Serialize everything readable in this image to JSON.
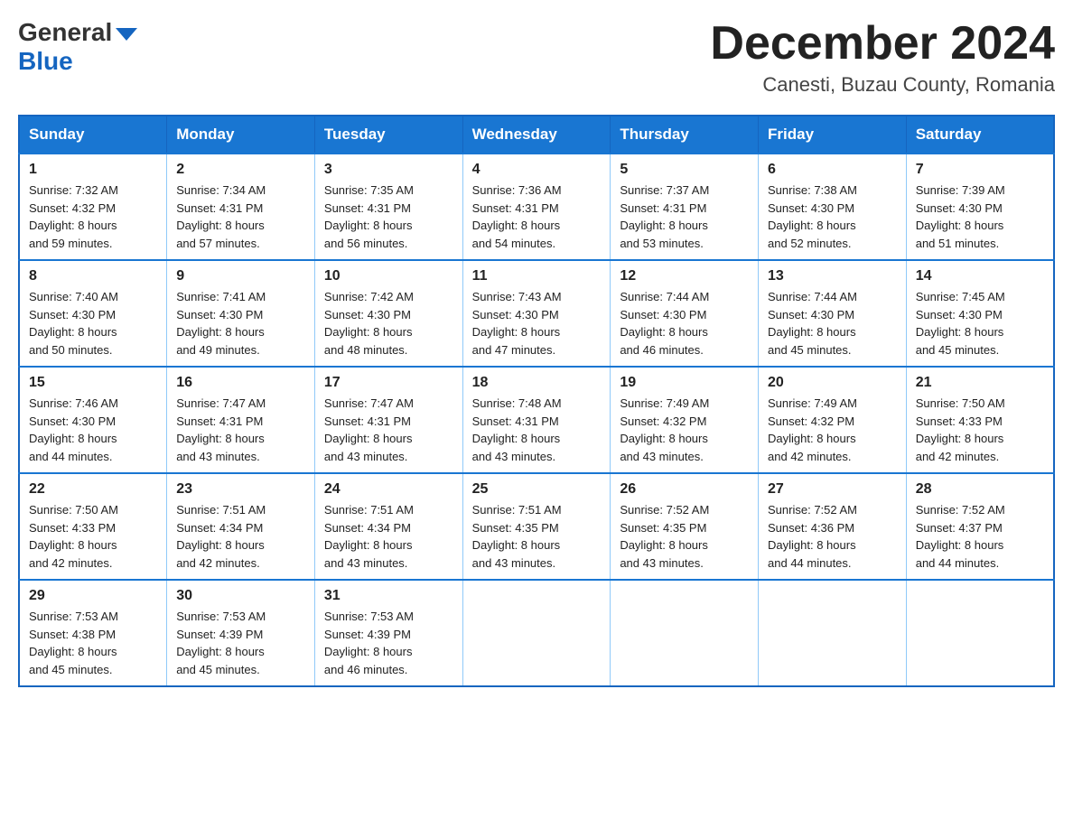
{
  "header": {
    "logo_general": "General",
    "logo_blue": "Blue",
    "month_title": "December 2024",
    "location": "Canesti, Buzau County, Romania"
  },
  "days_of_week": [
    "Sunday",
    "Monday",
    "Tuesday",
    "Wednesday",
    "Thursday",
    "Friday",
    "Saturday"
  ],
  "weeks": [
    [
      {
        "day": "1",
        "sunrise": "7:32 AM",
        "sunset": "4:32 PM",
        "daylight": "8 hours and 59 minutes."
      },
      {
        "day": "2",
        "sunrise": "7:34 AM",
        "sunset": "4:31 PM",
        "daylight": "8 hours and 57 minutes."
      },
      {
        "day": "3",
        "sunrise": "7:35 AM",
        "sunset": "4:31 PM",
        "daylight": "8 hours and 56 minutes."
      },
      {
        "day": "4",
        "sunrise": "7:36 AM",
        "sunset": "4:31 PM",
        "daylight": "8 hours and 54 minutes."
      },
      {
        "day": "5",
        "sunrise": "7:37 AM",
        "sunset": "4:31 PM",
        "daylight": "8 hours and 53 minutes."
      },
      {
        "day": "6",
        "sunrise": "7:38 AM",
        "sunset": "4:30 PM",
        "daylight": "8 hours and 52 minutes."
      },
      {
        "day": "7",
        "sunrise": "7:39 AM",
        "sunset": "4:30 PM",
        "daylight": "8 hours and 51 minutes."
      }
    ],
    [
      {
        "day": "8",
        "sunrise": "7:40 AM",
        "sunset": "4:30 PM",
        "daylight": "8 hours and 50 minutes."
      },
      {
        "day": "9",
        "sunrise": "7:41 AM",
        "sunset": "4:30 PM",
        "daylight": "8 hours and 49 minutes."
      },
      {
        "day": "10",
        "sunrise": "7:42 AM",
        "sunset": "4:30 PM",
        "daylight": "8 hours and 48 minutes."
      },
      {
        "day": "11",
        "sunrise": "7:43 AM",
        "sunset": "4:30 PM",
        "daylight": "8 hours and 47 minutes."
      },
      {
        "day": "12",
        "sunrise": "7:44 AM",
        "sunset": "4:30 PM",
        "daylight": "8 hours and 46 minutes."
      },
      {
        "day": "13",
        "sunrise": "7:44 AM",
        "sunset": "4:30 PM",
        "daylight": "8 hours and 45 minutes."
      },
      {
        "day": "14",
        "sunrise": "7:45 AM",
        "sunset": "4:30 PM",
        "daylight": "8 hours and 45 minutes."
      }
    ],
    [
      {
        "day": "15",
        "sunrise": "7:46 AM",
        "sunset": "4:30 PM",
        "daylight": "8 hours and 44 minutes."
      },
      {
        "day": "16",
        "sunrise": "7:47 AM",
        "sunset": "4:31 PM",
        "daylight": "8 hours and 43 minutes."
      },
      {
        "day": "17",
        "sunrise": "7:47 AM",
        "sunset": "4:31 PM",
        "daylight": "8 hours and 43 minutes."
      },
      {
        "day": "18",
        "sunrise": "7:48 AM",
        "sunset": "4:31 PM",
        "daylight": "8 hours and 43 minutes."
      },
      {
        "day": "19",
        "sunrise": "7:49 AM",
        "sunset": "4:32 PM",
        "daylight": "8 hours and 43 minutes."
      },
      {
        "day": "20",
        "sunrise": "7:49 AM",
        "sunset": "4:32 PM",
        "daylight": "8 hours and 42 minutes."
      },
      {
        "day": "21",
        "sunrise": "7:50 AM",
        "sunset": "4:33 PM",
        "daylight": "8 hours and 42 minutes."
      }
    ],
    [
      {
        "day": "22",
        "sunrise": "7:50 AM",
        "sunset": "4:33 PM",
        "daylight": "8 hours and 42 minutes."
      },
      {
        "day": "23",
        "sunrise": "7:51 AM",
        "sunset": "4:34 PM",
        "daylight": "8 hours and 42 minutes."
      },
      {
        "day": "24",
        "sunrise": "7:51 AM",
        "sunset": "4:34 PM",
        "daylight": "8 hours and 43 minutes."
      },
      {
        "day": "25",
        "sunrise": "7:51 AM",
        "sunset": "4:35 PM",
        "daylight": "8 hours and 43 minutes."
      },
      {
        "day": "26",
        "sunrise": "7:52 AM",
        "sunset": "4:35 PM",
        "daylight": "8 hours and 43 minutes."
      },
      {
        "day": "27",
        "sunrise": "7:52 AM",
        "sunset": "4:36 PM",
        "daylight": "8 hours and 44 minutes."
      },
      {
        "day": "28",
        "sunrise": "7:52 AM",
        "sunset": "4:37 PM",
        "daylight": "8 hours and 44 minutes."
      }
    ],
    [
      {
        "day": "29",
        "sunrise": "7:53 AM",
        "sunset": "4:38 PM",
        "daylight": "8 hours and 45 minutes."
      },
      {
        "day": "30",
        "sunrise": "7:53 AM",
        "sunset": "4:39 PM",
        "daylight": "8 hours and 45 minutes."
      },
      {
        "day": "31",
        "sunrise": "7:53 AM",
        "sunset": "4:39 PM",
        "daylight": "8 hours and 46 minutes."
      },
      null,
      null,
      null,
      null
    ]
  ],
  "labels": {
    "sunrise": "Sunrise:",
    "sunset": "Sunset:",
    "daylight": "Daylight:"
  }
}
